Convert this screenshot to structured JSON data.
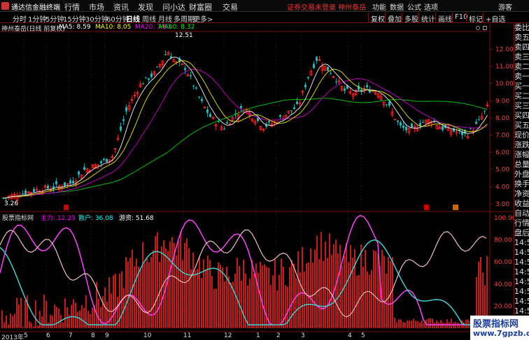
{
  "app": {
    "title": "通达信金融终端"
  },
  "menu": [
    "行情",
    "市场",
    "资讯",
    "发现",
    "问小达",
    "财富圈",
    "交易"
  ],
  "notice": "证券交易未登录   神州泰岳",
  "right_menu": [
    "功能",
    "数据",
    "公式",
    "选项"
  ],
  "guest": "游客",
  "periods": [
    {
      "label": "分时"
    },
    {
      "label": "1分钟"
    },
    {
      "label": "5分钟"
    },
    {
      "label": "15分钟"
    },
    {
      "label": "30分钟"
    },
    {
      "label": "60分钟"
    },
    {
      "label": "日线",
      "selected": true
    },
    {
      "label": "周线"
    },
    {
      "label": "月线"
    },
    {
      "label": "多周期"
    },
    {
      "label": "更多>"
    }
  ],
  "tools": [
    "复权",
    "叠加",
    "多股",
    "统计",
    "画线",
    "F10",
    "标记",
    "+自选"
  ],
  "ticker": {
    "name": "神州泰岳(日线 前复权)",
    "ma5": "MA5: 8.59",
    "ma10": "MA10: 8.05",
    "ma20": "MA20: 7.83",
    "ma60": "MA60: 8.32"
  },
  "price_axis": [
    "12.00",
    "11.00",
    "10.00",
    "9.00",
    "8.00",
    "7.00",
    "6.00",
    "5.00",
    "4.00",
    "3.00"
  ],
  "price_labels": {
    "high": "12.51",
    "low": "3.26"
  },
  "indicator": {
    "name": "股票指标网",
    "main": "主力: 12.23",
    "retail": "散户: 36.08",
    "hot": "游资: 51.68"
  },
  "indicator_axis": [
    "100.00",
    "80.00",
    "60.00",
    "40.00",
    "20.00"
  ],
  "side_panel": [
    "委比",
    "卖五",
    "卖四",
    "卖三",
    "卖二",
    "卖一",
    "买一",
    "买二",
    "买三",
    "买四",
    "买五",
    "现价",
    "涨跌",
    "涨幅",
    "总量",
    "外盘",
    "换手",
    "净资",
    "收益",
    "自动",
    "行情",
    "盘后",
    "14:5",
    "14:5",
    "14:5",
    "14:5",
    "14:5",
    "14:5",
    "14:5",
    "14:5",
    "14:5",
    "14:5"
  ],
  "dates": [
    "2013年",
    "5",
    "6",
    "7",
    "8",
    "9",
    "10",
    "11",
    "12",
    "1",
    "2",
    "3",
    "4",
    "5"
  ],
  "watermark": {
    "line1": "股票指标网",
    "line2": "www.7gpzb.com"
  },
  "colors": {
    "up": "#ff3030",
    "down": "#00c8c8",
    "ma5": "#ffffff",
    "ma10": "#ffff00",
    "ma20": "#ff00ff",
    "ma60": "#00ff00"
  }
}
